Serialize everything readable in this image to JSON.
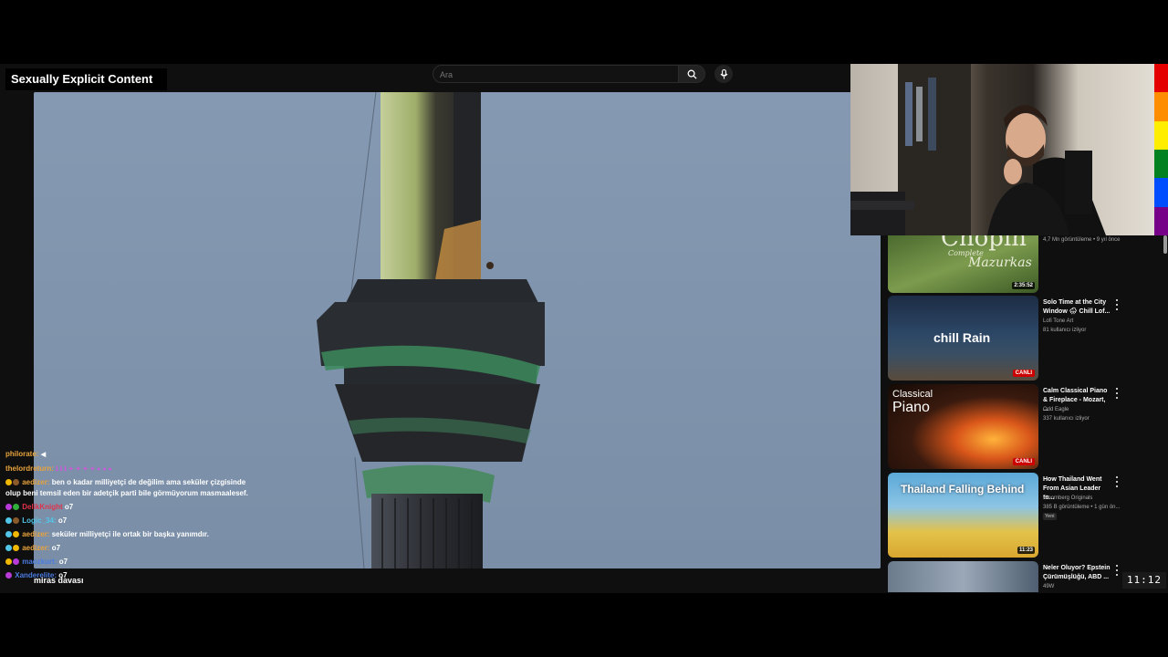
{
  "overlay": {
    "content_warning": "Sexually Explicit Content",
    "caption": "miras davası",
    "clock": "11:12"
  },
  "search": {
    "placeholder": "Ara"
  },
  "chat": [
    {
      "user": "philorate:",
      "user_color": "#e8a33c",
      "text": ""
    },
    {
      "user": "thelordreturn:",
      "user_color": "#e8a33c",
      "text": ""
    },
    {
      "user": "aedizer:",
      "user_color": "#e8a33c",
      "text": "ben o kadar milliyetçi de değilim ama seküler çizgisinde olup beni temsil eden bir adetçik parti bile görmüyorum masmaalesef."
    },
    {
      "user": "DelikKnight",
      "user_color": "#e0324b",
      "text": "o7"
    },
    {
      "user": "Logic_34:",
      "user_color": "#51c6e8",
      "text": "o7"
    },
    {
      "user": "aedizer:",
      "user_color": "#e8a33c",
      "text": "seküler milliyetçi ile ortak bir başka yanımdır."
    },
    {
      "user": "aedizer:",
      "user_color": "#e8a33c",
      "text": "o7"
    },
    {
      "user": "maozkurt:",
      "user_color": "#4a7be0",
      "text": "o7"
    },
    {
      "user": "Xanderelite:",
      "user_color": "#4a7be0",
      "text": "o7"
    }
  ],
  "recommendations": {
    "first_meta": "4,7 Mn görüntüleme • 9 yıl önce",
    "items": [
      {
        "thumb_text_1": "Chopin",
        "thumb_text_2": "Complete",
        "thumb_text_3": "Mazurkas",
        "duration": "2:35:52",
        "title": "",
        "channel": "",
        "meta": "",
        "live": ""
      },
      {
        "thumb_text_1": "chill Rain",
        "duration": "",
        "live": "CANLI",
        "title": "Solo Time at the City Window 🌧 Chill Lof...",
        "channel": "Lofi Tone Art",
        "meta": "81 kullanıcı izliyor"
      },
      {
        "thumb_text_1": "Classical",
        "thumb_text_2": "Piano",
        "duration": "",
        "live": "CANLI",
        "title": "Calm Classical Piano & Fireplace - Mozart, ...",
        "channel": "Odd Eagle",
        "meta": "337 kullanıcı izliyor"
      },
      {
        "thumb_text_1": "Thailand Falling Behind",
        "duration": "11:23",
        "live": "",
        "title": "How Thailand Went From Asian Leader to...",
        "channel": "Bloomberg Originals",
        "meta": "385 B görüntüleme • 1 gün ön...",
        "badge": "Yeni"
      },
      {
        "thumb_text_1": "",
        "duration": "",
        "live": "",
        "title": "Neler Oluyor? Epstein Çürümüşlüğü, ABD ...",
        "channel": "49W",
        "meta": ""
      }
    ]
  },
  "colors": {
    "rainbow": [
      "#e50000",
      "#ff8d00",
      "#ffee00",
      "#028121",
      "#004cff",
      "#770088"
    ]
  }
}
